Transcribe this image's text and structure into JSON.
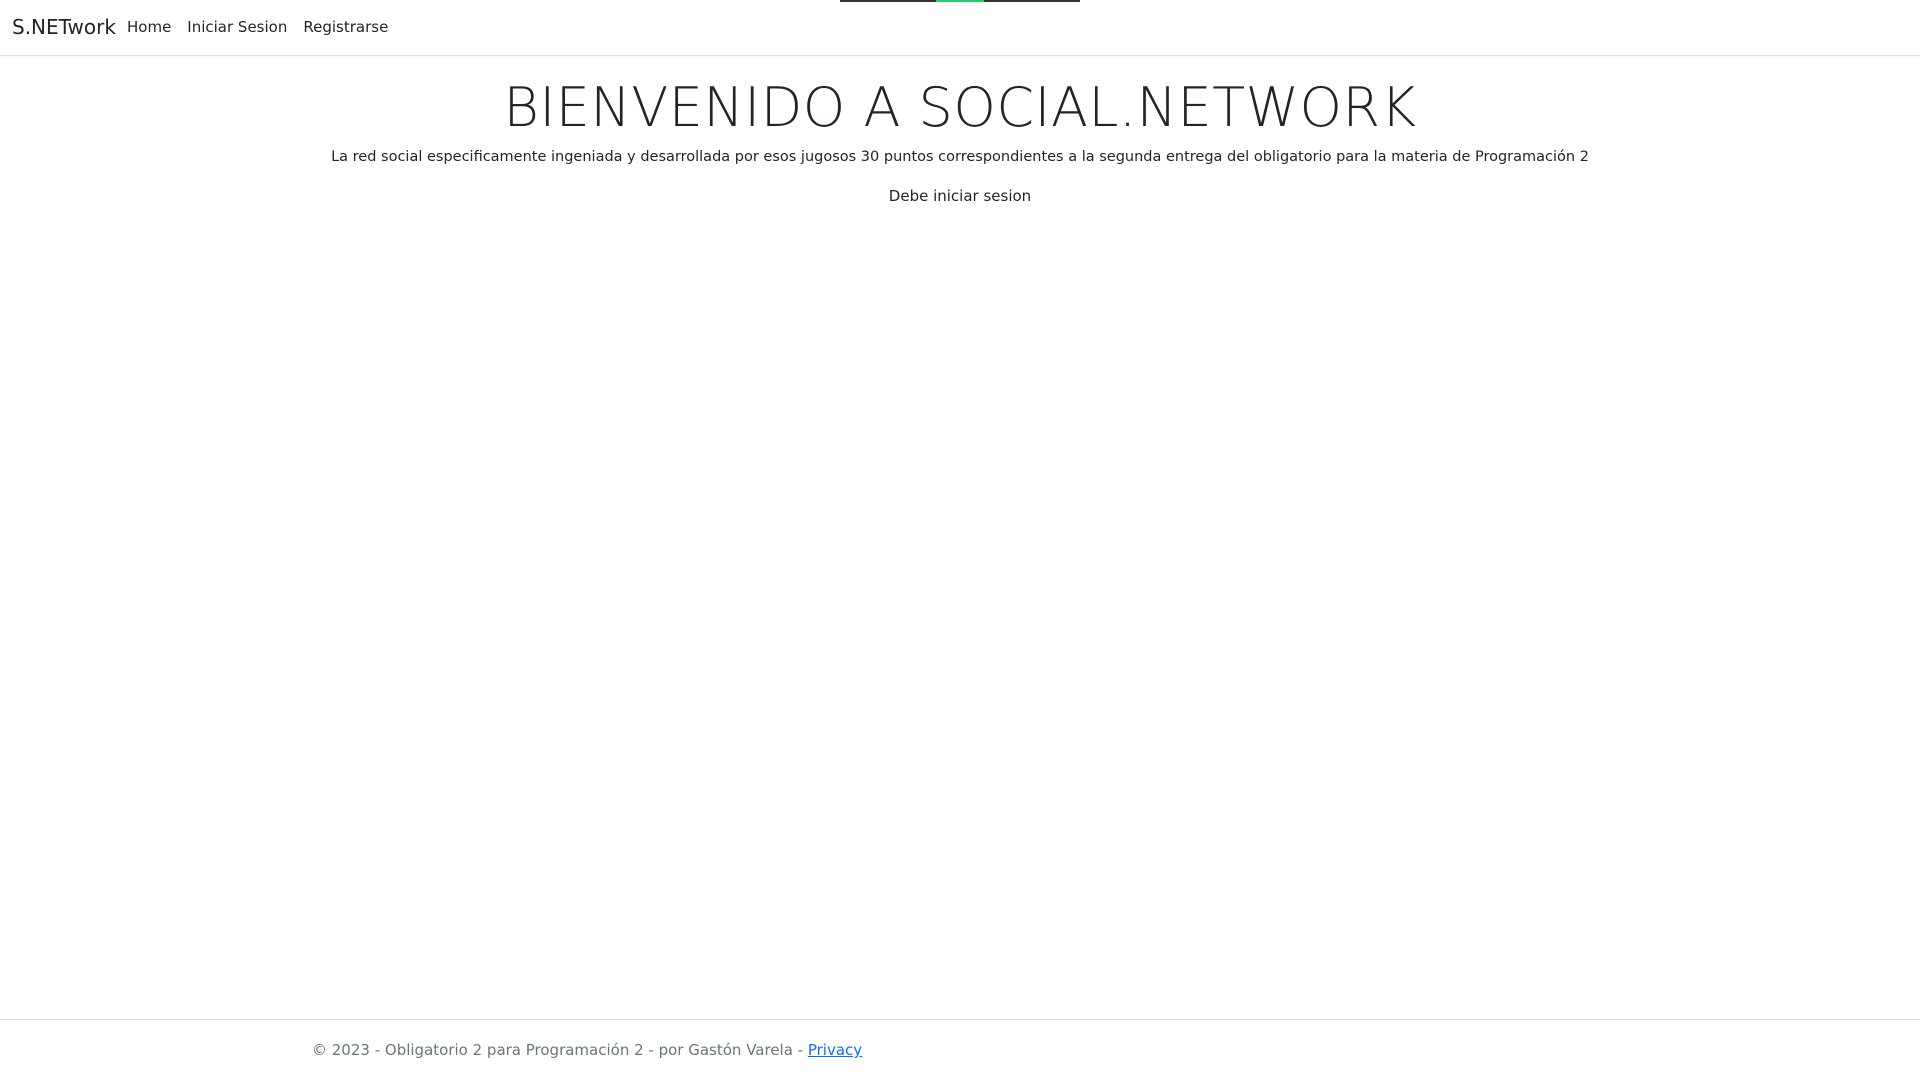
{
  "navbar": {
    "brand": "S.NETwork",
    "links": [
      {
        "label": "Home"
      },
      {
        "label": "Iniciar Sesion"
      },
      {
        "label": "Registrarse"
      }
    ]
  },
  "main": {
    "title": "BIENVENIDO A SOCIAL.NETWORK",
    "description": "La red social especificamente ingeniada y desarrollada por esos jugosos 30 puntos correspondientes a la segunda entrega del obligatorio para la materia de Programación 2",
    "notice": "Debe iniciar sesion"
  },
  "footer": {
    "text": "© 2023 - Obligatorio 2 para Programación 2 - por Gastón Varela - ",
    "privacy_label": "Privacy"
  },
  "colors": {
    "link": "#0d6efd",
    "muted": "#6c757d",
    "border": "#dee2e6",
    "top_accent": "#2ecc71"
  }
}
